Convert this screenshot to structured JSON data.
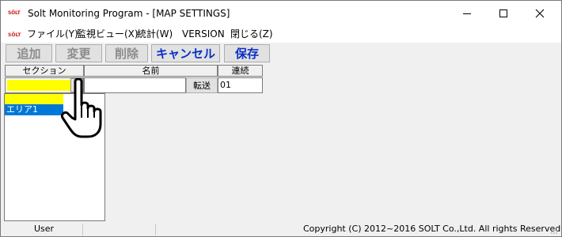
{
  "window": {
    "logo_text": "SOLT",
    "title": "Solt Monitoring Program - [MAP SETTINGS]",
    "controls": {
      "minimize": "minimize",
      "maximize": "maximize",
      "close": "close"
    }
  },
  "menu": {
    "logo_text": "SOLT",
    "items": [
      "ファイル(Y)",
      "監視ビュー(X)",
      "統計(W)",
      "VERSION",
      "閉じる(Z)"
    ]
  },
  "toolbar": {
    "add_label": "追加",
    "change_label": "変更",
    "delete_label": "削除",
    "cancel_label": "キャンセル",
    "save_label": "保存"
  },
  "grid": {
    "headers": {
      "section": "セクション",
      "name": "名前",
      "renzoku": "連続"
    },
    "section_value": "",
    "name_value": "",
    "send_label": "転送",
    "renzoku_value": "01"
  },
  "dropdown": {
    "options": [
      "",
      "エリア1"
    ],
    "highlighted": "エリア1"
  },
  "status": {
    "user": "User",
    "copyright": "Copyright (C) 2012~2016 SOLT Co.,Ltd. All rights Reserved."
  },
  "colors": {
    "selected_field": "#ffff00",
    "list_highlight": "#0078d7",
    "active_button_text": "#0a2fc8",
    "logo": "#cc1e1e"
  },
  "icons": {
    "cursor": "hand-pointer-icon"
  }
}
